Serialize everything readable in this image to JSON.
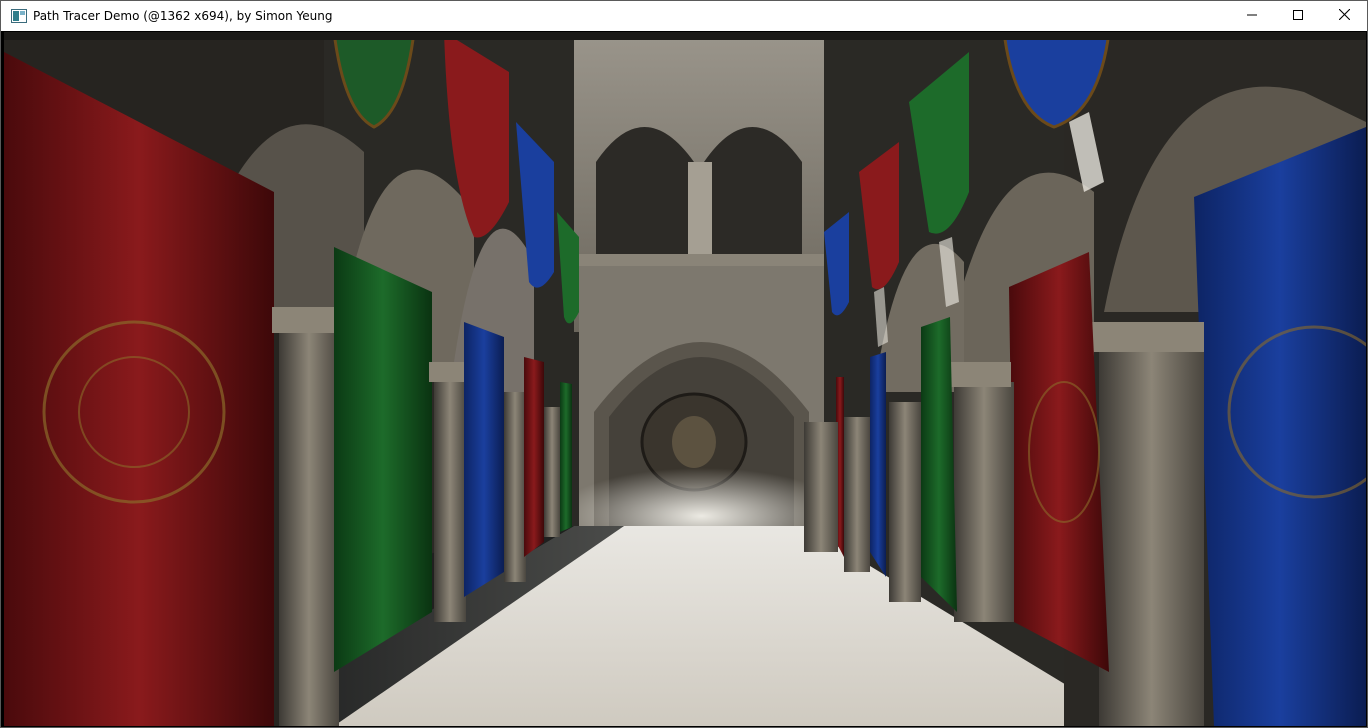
{
  "window": {
    "title": "Path Tracer Demo (@1362 x694), by Simon Yeung",
    "app_icon": "app-window-icon",
    "controls": [
      {
        "name": "minimize-button",
        "icon": "minimize-icon"
      },
      {
        "name": "maximize-button",
        "icon": "maximize-icon"
      },
      {
        "name": "close-button",
        "icon": "close-icon"
      }
    ]
  },
  "scene": {
    "description_icon": "rendered-3d-scene",
    "banner_colors": {
      "red": "#8a1a1c",
      "green": "#1d6b2a",
      "blue": "#1a3f9e"
    },
    "floor_color": "#d8d6d0",
    "stone_color": "#8c8577"
  }
}
